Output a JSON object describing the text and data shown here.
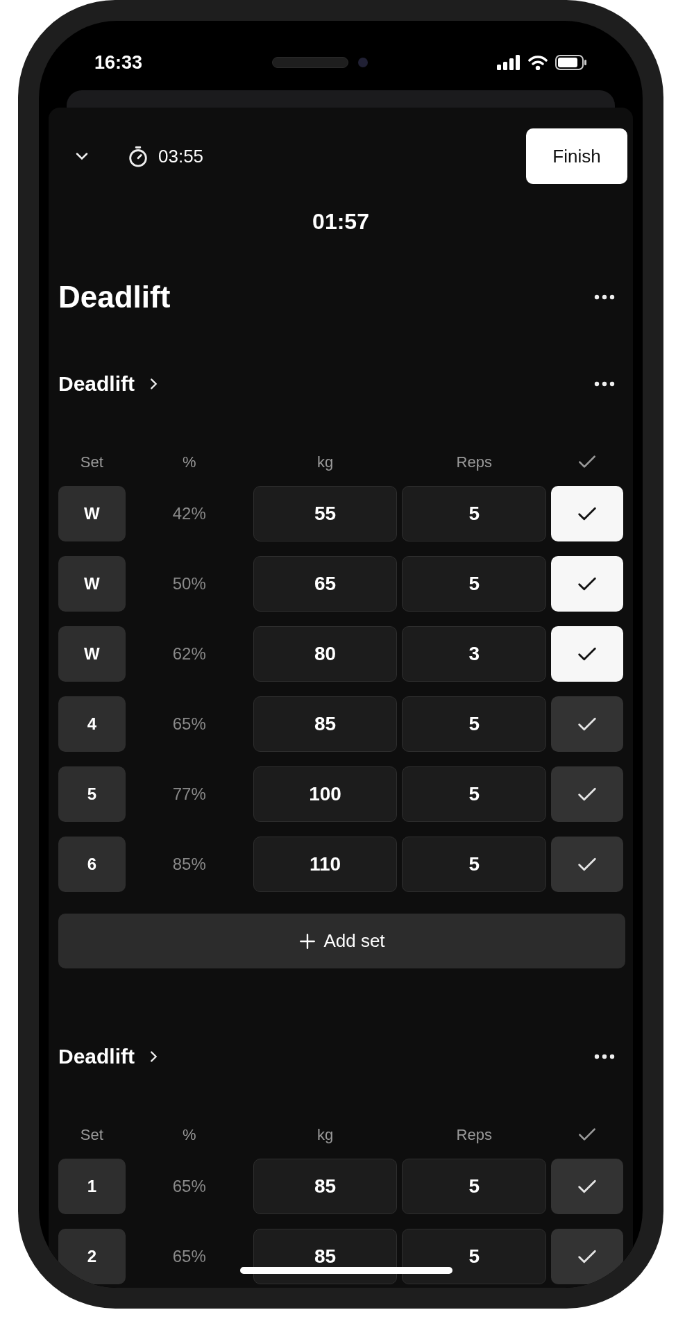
{
  "status_bar": {
    "time": "16:33"
  },
  "header": {
    "timer": "03:55",
    "finish": "Finish",
    "rest_timer": "01:57"
  },
  "workout": {
    "title": "Deadlift"
  },
  "exercises": [
    {
      "name": "Deadlift",
      "columns": [
        "Set",
        "%",
        "kg",
        "Reps"
      ],
      "sets": [
        {
          "set": "W",
          "percent": "42%",
          "kg": "55",
          "reps": "5",
          "done": true
        },
        {
          "set": "W",
          "percent": "50%",
          "kg": "65",
          "reps": "5",
          "done": true
        },
        {
          "set": "W",
          "percent": "62%",
          "kg": "80",
          "reps": "3",
          "done": true
        },
        {
          "set": "4",
          "percent": "65%",
          "kg": "85",
          "reps": "5",
          "done": false
        },
        {
          "set": "5",
          "percent": "77%",
          "kg": "100",
          "reps": "5",
          "done": false
        },
        {
          "set": "6",
          "percent": "85%",
          "kg": "110",
          "reps": "5",
          "done": false
        }
      ],
      "add_set": "Add set"
    },
    {
      "name": "Deadlift",
      "columns": [
        "Set",
        "%",
        "kg",
        "Reps"
      ],
      "sets": [
        {
          "set": "1",
          "percent": "65%",
          "kg": "85",
          "reps": "5",
          "done": false
        },
        {
          "set": "2",
          "percent": "65%",
          "kg": "85",
          "reps": "5",
          "done": false
        }
      ]
    }
  ]
}
